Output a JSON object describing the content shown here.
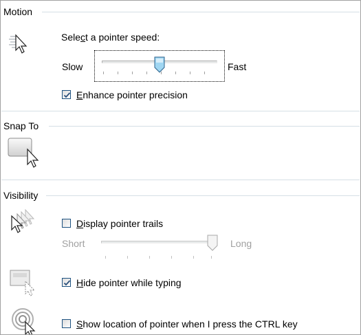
{
  "motion": {
    "title": "Motion",
    "speed_label_pre": "Sele",
    "speed_label_accel": "c",
    "speed_label_post": "t a pointer speed:",
    "slow_label": "Slow",
    "fast_label": "Fast",
    "speed_value": 0.5,
    "enhance_accel": "E",
    "enhance_rest": "nhance pointer precision",
    "enhance_checked": true
  },
  "snap_to": {
    "title": "Snap To"
  },
  "visibility": {
    "title": "Visibility",
    "trails_accel": "D",
    "trails_rest": "isplay pointer trails",
    "trails_checked": false,
    "short_label": "Short",
    "long_label": "Long",
    "trail_length_value": 1.0,
    "hide_accel": "H",
    "hide_rest": "ide pointer while typing",
    "hide_checked": true,
    "show_accel": "S",
    "show_rest": "how location of pointer when I press the CTRL key",
    "show_checked": false
  },
  "colors": {
    "divider": "#d5dfe5",
    "check": "#2a4f7a",
    "thumb_fill": "#9fd6f2",
    "thumb_border": "#2c628b"
  }
}
